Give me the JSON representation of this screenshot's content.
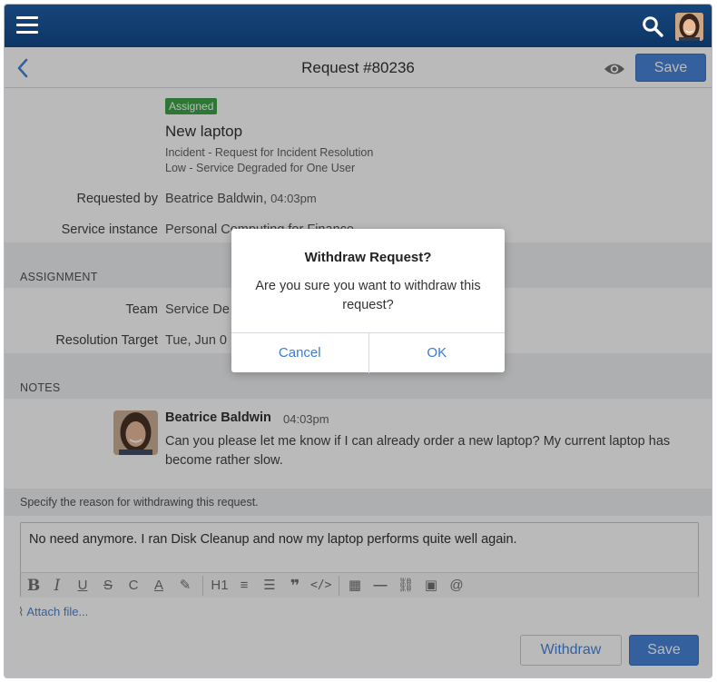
{
  "header": {
    "request_title": "Request #80236",
    "save_label": "Save",
    "icons": {
      "menu": "hamburger-icon",
      "search": "search-icon",
      "back": "chevron-left-icon",
      "watch": "eye-icon"
    }
  },
  "request": {
    "status_badge": "Assigned",
    "subject": "New laptop",
    "category": "Incident - Request for Incident Resolution",
    "impact": "Low - Service Degraded for One User",
    "requested_by_label": "Requested by",
    "requested_by_name": "Beatrice Baldwin,",
    "requested_by_time": "04:03pm",
    "service_instance_label": "Service instance",
    "service_instance_value": "Personal Computing for Finance"
  },
  "assignment": {
    "section_title": "ASSIGNMENT",
    "team_label": "Team",
    "team_value": "Service De",
    "resolution_label": "Resolution Target",
    "resolution_value": "Tue, Jun 0"
  },
  "notes": {
    "section_title": "NOTES",
    "items": [
      {
        "author": "Beatrice Baldwin",
        "time": "04:03pm",
        "text": "Can you please let me know if I can already order a new laptop? My current laptop has become rather slow."
      }
    ]
  },
  "withdraw_form": {
    "reason_label": "Specify the reason for withdrawing this request.",
    "reason_value": "No need anymore. I ran Disk Cleanup and now my laptop performs quite well again.",
    "attach_label": "Attach file...",
    "withdraw_label": "Withdraw",
    "save_label": "Save",
    "toolbar_icons": [
      "bold-icon",
      "italic-icon",
      "underline-icon",
      "strikethrough-icon",
      "clear-format-icon",
      "font-color-icon",
      "highlight-icon",
      "heading-icon",
      "ordered-list-icon",
      "bullet-list-icon",
      "quote-icon",
      "code-icon",
      "table-icon",
      "horizontal-rule-icon",
      "link-icon",
      "image-icon",
      "mention-icon"
    ]
  },
  "dialog": {
    "title": "Withdraw Request?",
    "message": "Are you sure you want to withdraw this request?",
    "cancel_label": "Cancel",
    "ok_label": "OK"
  },
  "colors": {
    "topbar": "#0d3566",
    "accent": "#3a7bd6",
    "badge": "#2e9c3c",
    "overlay": "rgba(40,40,40,0.32)"
  }
}
